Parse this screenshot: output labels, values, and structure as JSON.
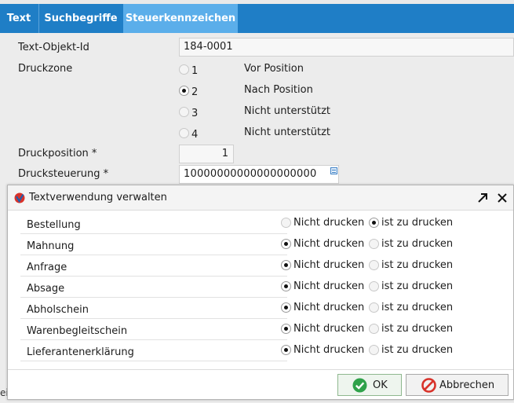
{
  "tabs": [
    {
      "label": "Text"
    },
    {
      "label": "Suchbegriffe"
    },
    {
      "label": "Steuerkennzeichen"
    }
  ],
  "form": {
    "text_objekt_id": {
      "label": "Text-Objekt-Id",
      "value": "184-0001"
    },
    "druckzone": {
      "label": "Druckzone",
      "options": [
        {
          "num": "1",
          "desc": "Vor Position",
          "selected": false
        },
        {
          "num": "2",
          "desc": "Nach Position",
          "selected": true
        },
        {
          "num": "3",
          "desc": "Nicht unterstützt",
          "selected": false
        },
        {
          "num": "4",
          "desc": "Nicht unterstützt",
          "selected": false
        }
      ]
    },
    "druckposition": {
      "label": "Druckposition *",
      "value": "1"
    },
    "drucksteuerung": {
      "label": "Drucksteuerung *",
      "value": "10000000000000000000"
    },
    "bottom_stub": "ei"
  },
  "dialog": {
    "title": "Textverwendung verwalten",
    "option_labels": {
      "not_print": "Nicht drucken",
      "print": "ist zu drucken"
    },
    "rows": [
      {
        "label": "Bestellung",
        "value": "print"
      },
      {
        "label": "Mahnung",
        "value": "not_print"
      },
      {
        "label": "Anfrage",
        "value": "not_print"
      },
      {
        "label": "Absage",
        "value": "not_print"
      },
      {
        "label": "Abholschein",
        "value": "not_print"
      },
      {
        "label": "Warenbegleitschein",
        "value": "not_print"
      },
      {
        "label": "Lieferantenerklärung",
        "value": "not_print"
      }
    ],
    "ok_label": "OK",
    "cancel_label": "Abbrechen"
  },
  "colors": {
    "tab_bar": "#1f7ec6",
    "tab_active": "#5baeea",
    "ok_icon": "#2fa24a",
    "cancel_icon": "#d8322a"
  },
  "icons": {
    "app": "app-logo-icon",
    "maximize": "maximize-arrow-icon",
    "close": "close-icon",
    "ok": "check-circle-icon",
    "cancel": "no-entry-icon",
    "edit": "edit-field-icon"
  }
}
